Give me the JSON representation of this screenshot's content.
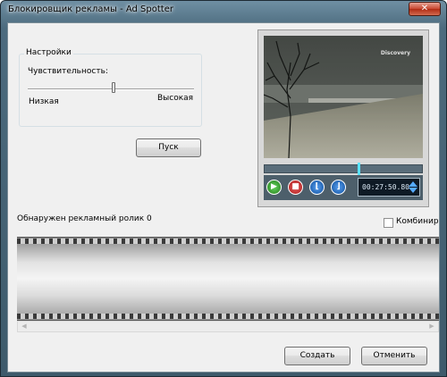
{
  "window": {
    "title": "Блокировщик рекламы - Ad Spotter",
    "close_label": "✕"
  },
  "settings": {
    "group_title": "Настройки",
    "sensitivity_label": "Чувствительность:",
    "low_label": "Низкая",
    "high_label": "Высокая",
    "sensitivity_value": 0.55
  },
  "start_button": "Пуск",
  "player": {
    "logo_text": "Discovery",
    "time": "00:27:50.80",
    "seek_fraction": 0.59,
    "icons": {
      "play": "play-icon",
      "stop": "stop-icon",
      "mark_in": "mark-in-icon",
      "mark_out": "mark-out-icon"
    }
  },
  "detected_text": "Обнаружен рекламный ролик 0",
  "combine_label": "Комбинир",
  "footer": {
    "create": "Создать",
    "cancel": "Отменить"
  },
  "colors": {
    "play": "#2a9d21",
    "stop": "#c01818",
    "mark": "#1761c2",
    "time_bg": "#0e1a25"
  }
}
